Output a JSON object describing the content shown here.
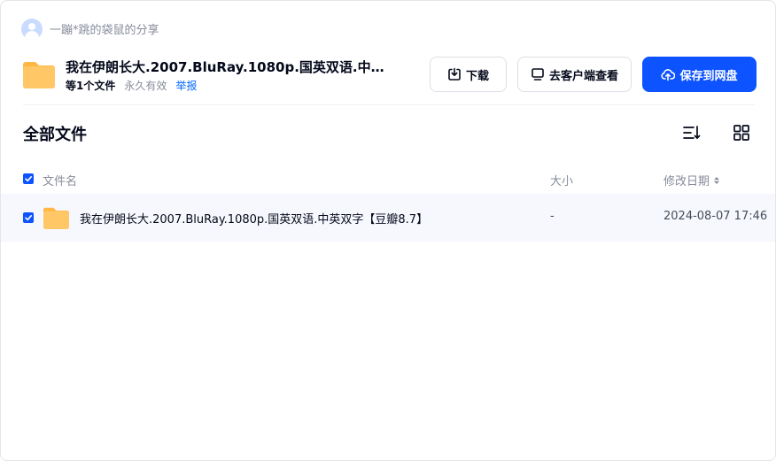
{
  "sharer": {
    "name_text": "一蹦*跳的袋鼠的分享",
    "avatar_icon": "user-avatar-icon"
  },
  "share": {
    "title": "我在伊朗长大.2007.BluRay.1080p.国英双语.中英...",
    "count": "等1个文件",
    "validity": "永久有效",
    "report": "举报",
    "icon": "folder-icon"
  },
  "actions": {
    "download": {
      "label": "下载",
      "icon": "download-icon"
    },
    "client": {
      "label": "去客户端查看",
      "icon": "monitor-icon"
    },
    "save": {
      "label": "保存到网盘",
      "icon": "cloud-upload-icon"
    }
  },
  "section": {
    "title": "全部文件",
    "sort_icon": "sort-list-icon",
    "view_icon": "grid-view-icon"
  },
  "table": {
    "columns": {
      "name": "文件名",
      "size": "大小",
      "modified": "修改日期"
    },
    "rows": [
      {
        "name": "我在伊朗长大.2007.BluRay.1080p.国英双语.中英双字【豆瓣8.7】",
        "size": "-",
        "modified": "2024-08-07 17:46",
        "checked": true
      }
    ]
  },
  "colors": {
    "primary": "#0d53ff",
    "link": "#0666ff",
    "folder": "#ffc766",
    "row_bg": "#f7f8fd",
    "text": "#03081a",
    "muted": "#878c9c"
  }
}
